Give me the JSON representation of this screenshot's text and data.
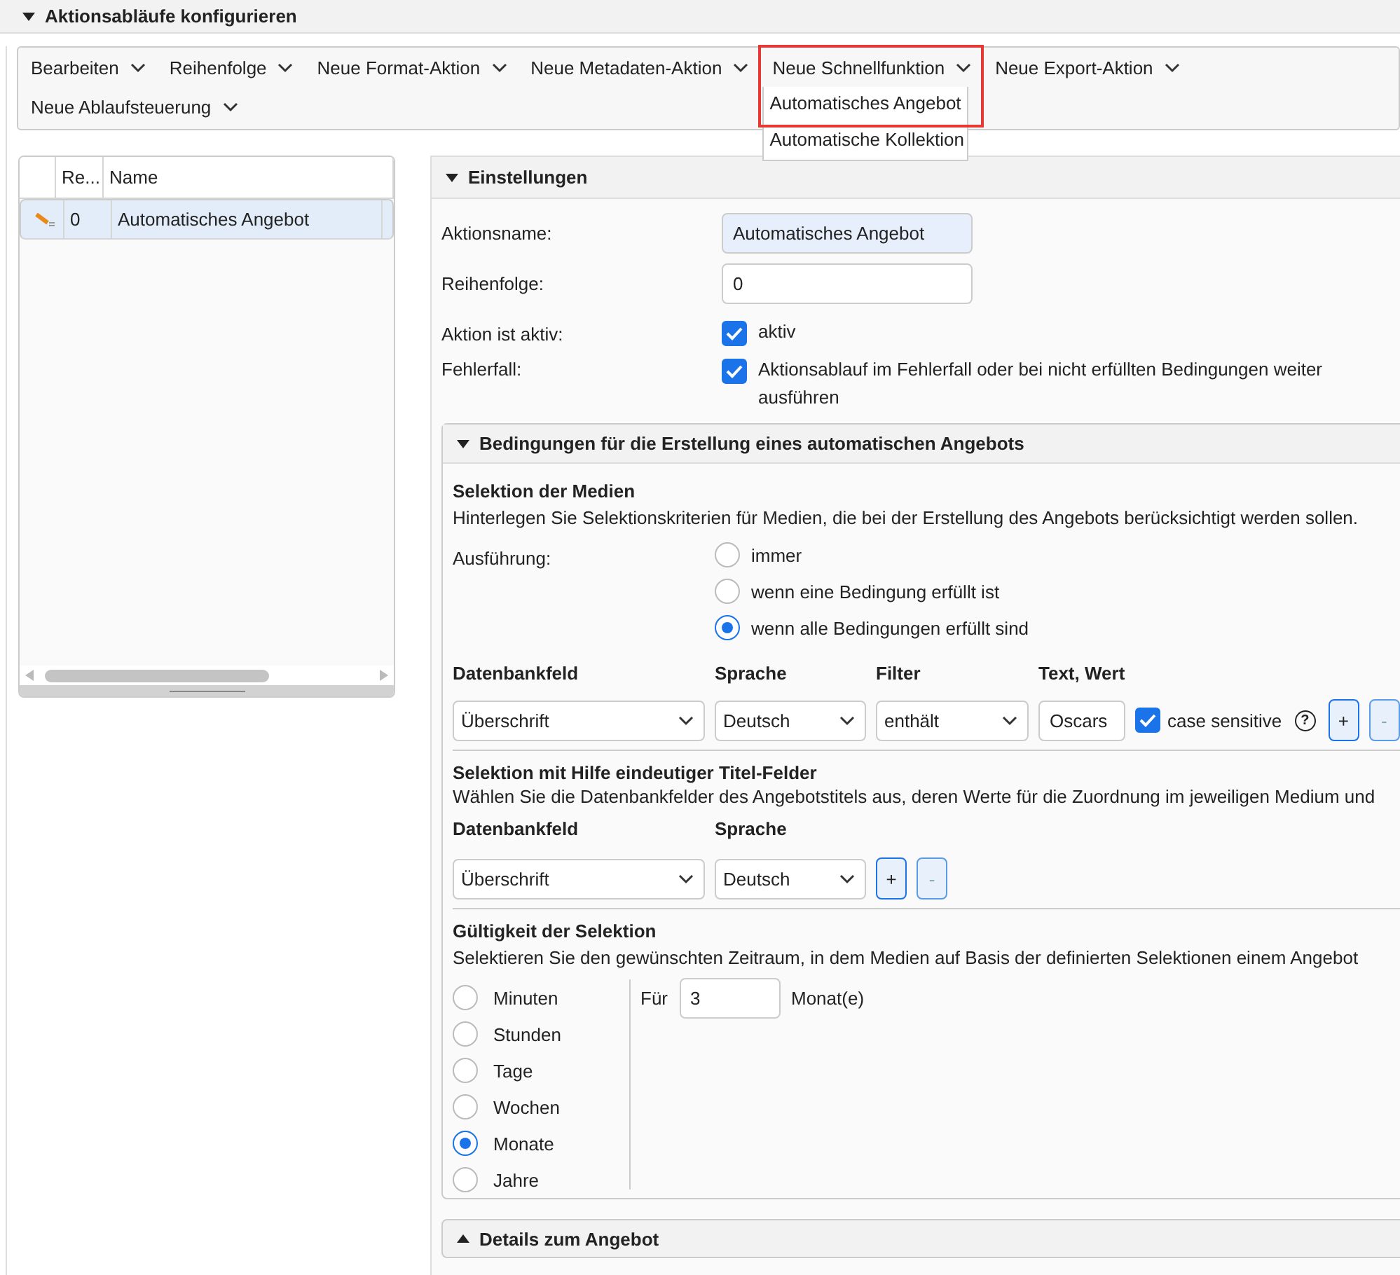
{
  "header": {
    "title": "Aktionsabläufe konfigurieren",
    "expanded": true
  },
  "menu": {
    "items": [
      {
        "label": "Bearbeiten"
      },
      {
        "label": "Reihenfolge"
      },
      {
        "label": "Neue Format-Aktion"
      },
      {
        "label": "Neue Metadaten-Aktion"
      },
      {
        "label": "Neue Schnellfunktion",
        "expanded": true,
        "highlighted": true,
        "options": [
          "Automatisches Angebot",
          "Automatische Kollektion"
        ]
      },
      {
        "label": "Neue Export-Aktion"
      },
      {
        "label": "Neue Ablaufsteuerung"
      }
    ]
  },
  "action_list": {
    "columns": [
      "Re...",
      "Name"
    ],
    "rows": [
      {
        "cells": [
          "0",
          "Automatisches Angebot"
        ],
        "selected": true
      }
    ]
  },
  "settings": {
    "title": "Einstellungen",
    "expanded": true,
    "fields": [
      {
        "kind": "text",
        "label": "Aktionsname:",
        "value": "Automatisches Angebot",
        "highlighted": true
      },
      {
        "kind": "text",
        "label": "Reihenfolge:",
        "value": "0",
        "highlighted": false
      },
      {
        "kind": "checkbox",
        "label": "Aktion ist aktiv:",
        "text": "aktiv",
        "checked": true
      },
      {
        "kind": "checkbox",
        "label": "Fehlerfall:",
        "text": "Aktionsablauf im Fehlerfall oder bei nicht erfüllten Bedingungen weiter ausführen",
        "checked": true
      }
    ]
  },
  "conditions": {
    "title": "Bedingungen für die Erstellung eines automatischen Angebots",
    "expanded": true,
    "media_selection": {
      "heading": "Selektion der Medien",
      "description": "Hinterlegen Sie Selektionskriterien für Medien, die bei der Erstellung des Angebots berücksichtigt werden sollen.",
      "execution_label": "Ausführung:",
      "options": [
        {
          "label": "immer",
          "selected": false
        },
        {
          "label": "wenn eine Bedingung erfüllt ist",
          "selected": false
        },
        {
          "label": "wenn alle Bedingungen erfüllt sind",
          "selected": true
        }
      ],
      "columns": [
        "Datenbankfeld",
        "Sprache",
        "Filter",
        "Text, Wert"
      ],
      "row": {
        "field": "Überschrift",
        "language": "Deutsch",
        "filter": "enthält",
        "value": "Oscars",
        "case_sensitive": {
          "label": "case sensitive",
          "checked": true
        },
        "help": "?",
        "add": {
          "label": "+",
          "disabled": false
        },
        "remove": {
          "label": "-",
          "disabled": true
        }
      }
    },
    "title_selection": {
      "heading": "Selektion mit Hilfe eindeutiger Titel-Felder",
      "description": "Wählen Sie die Datenbankfelder des Angebotstitels aus, deren Werte für die Zuordnung im jeweiligen Medium und",
      "columns": [
        "Datenbankfeld",
        "Sprache"
      ],
      "row": {
        "field": "Überschrift",
        "language": "Deutsch",
        "add": {
          "label": "+",
          "disabled": false
        },
        "remove": {
          "label": "-",
          "disabled": true
        }
      }
    },
    "validity": {
      "heading": "Gültigkeit der Selektion",
      "description": "Selektieren Sie den gewünschten Zeitraum, in dem Medien auf Basis der definierten Selektionen einem Angebot",
      "units": [
        {
          "label": "Minuten",
          "selected": false
        },
        {
          "label": "Stunden",
          "selected": false
        },
        {
          "label": "Tage",
          "selected": false
        },
        {
          "label": "Wochen",
          "selected": false
        },
        {
          "label": "Monate",
          "selected": true
        },
        {
          "label": "Jahre",
          "selected": false
        }
      ],
      "for_label": "Für",
      "amount": "3",
      "unit_label": "Monat(e)"
    }
  },
  "details": {
    "title": "Details zum Angebot",
    "expanded": false
  }
}
